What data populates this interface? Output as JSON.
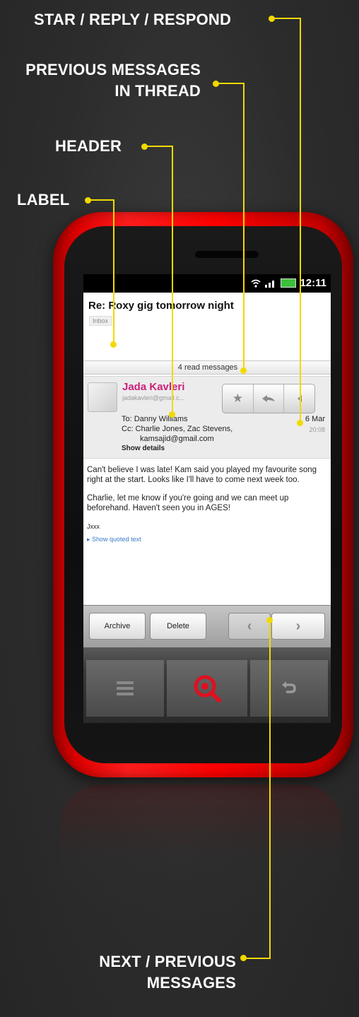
{
  "callouts": {
    "star_reply": "STAR / REPLY / RESPOND",
    "previous_line1": "PREVIOUS MESSAGES",
    "previous_line2": "IN THREAD",
    "header": "HEADER",
    "label": "LABEL",
    "next_line1": "NEXT / PREVIOUS",
    "next_line2": "MESSAGES"
  },
  "colors": {
    "callout_line": "#f2d900",
    "phone_body": "#ff1d1d",
    "sender_name": "#cc1f7a",
    "search_key": "#e01020"
  },
  "status_bar": {
    "time": "12:11",
    "icons": [
      "wifi-icon",
      "signal-icon",
      "battery-icon"
    ]
  },
  "email": {
    "subject": "Re: Roxy gig tomorrow night",
    "label": "Inbox",
    "read_messages": "4 read messages",
    "sender_name": "Jada Kavleri",
    "sender_email": "jadakavleri@gmail.c...",
    "to": "To: Danny Williams",
    "cc_line1": "Cc: Charlie Jones, Zac Stevens,",
    "cc_line2": "kamsajid@gmail.com",
    "show_details": "Show details",
    "date": "6 Mar",
    "time": "20:08",
    "body_p1": "Can't believe I was late! Kam said you played my favourite song right at the start. Looks like I'll have to come next week too.",
    "body_p2": "Charlie, let me know if you're going and we can meet up beforehand. Haven't seen you in AGES!",
    "signoff": "Jxxx",
    "quoted_link": "Show quoted text"
  },
  "actions": {
    "star_icon": "star-icon",
    "reply_icon": "reply-icon",
    "respond_icon": "respond-menu-icon"
  },
  "buttons": {
    "archive": "Archive",
    "delete": "Delete",
    "prev_icon": "chevron-left-icon",
    "next_icon": "chevron-right-icon"
  },
  "hardware_keys": [
    "menu-icon",
    "search-icon",
    "back-icon"
  ]
}
